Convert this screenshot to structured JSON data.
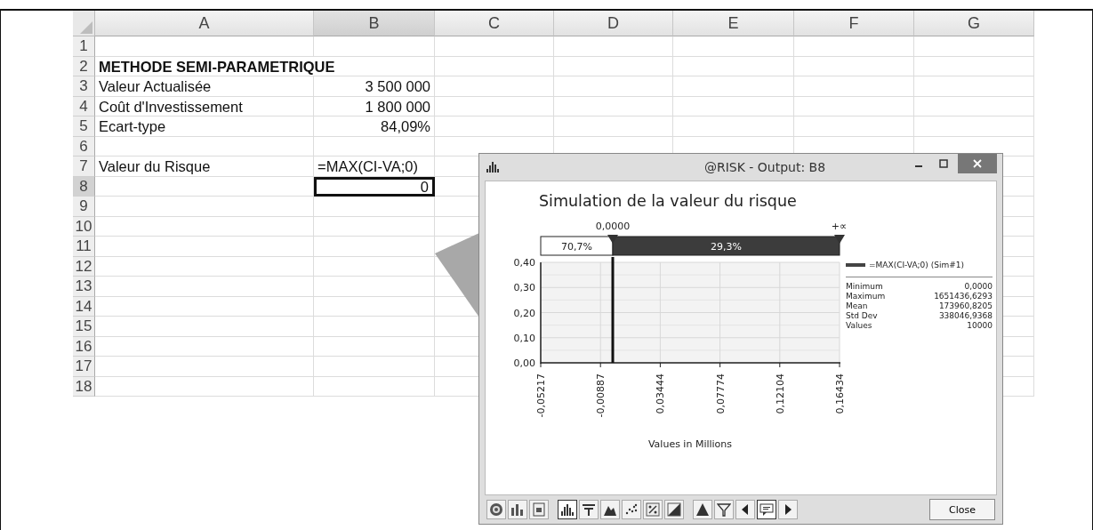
{
  "sheet": {
    "columns": [
      {
        "label": "A",
        "selected": false
      },
      {
        "label": "B",
        "selected": true
      },
      {
        "label": "C",
        "selected": false
      },
      {
        "label": "D",
        "selected": false
      },
      {
        "label": "E",
        "selected": false
      },
      {
        "label": "F",
        "selected": false
      },
      {
        "label": "G",
        "selected": false
      }
    ],
    "rows": [
      {
        "header": "1",
        "selected": false
      },
      {
        "header": "2",
        "selected": false,
        "a": {
          "text": "METHODE SEMI-PARAMETRIQUE",
          "bold": true
        }
      },
      {
        "header": "3",
        "selected": false,
        "a": {
          "text": "Valeur Actualisée",
          "bold": false
        },
        "b": {
          "text": "3 500 000",
          "kind": "number"
        }
      },
      {
        "header": "4",
        "selected": false,
        "a": {
          "text": "Coût d'Investissement",
          "bold": false
        },
        "b": {
          "text": "1 800 000",
          "kind": "number"
        }
      },
      {
        "header": "5",
        "selected": false,
        "a": {
          "text": "Ecart-type",
          "bold": false
        },
        "b": {
          "text": "84,09%",
          "kind": "number"
        }
      },
      {
        "header": "6",
        "selected": false
      },
      {
        "header": "7",
        "selected": false,
        "a": {
          "text": "Valeur du Risque",
          "bold": false
        },
        "b": {
          "text": "=MAX(CI-VA;0)",
          "kind": "text"
        }
      },
      {
        "header": "8",
        "selected": true,
        "b": {
          "text": "0",
          "kind": "number"
        }
      },
      {
        "header": "9",
        "selected": false
      },
      {
        "header": "10",
        "selected": false
      },
      {
        "header": "11",
        "selected": false
      },
      {
        "header": "12",
        "selected": false
      },
      {
        "header": "13",
        "selected": false
      },
      {
        "header": "14",
        "selected": false
      },
      {
        "header": "15",
        "selected": false
      },
      {
        "header": "16",
        "selected": false
      },
      {
        "header": "17",
        "selected": false
      },
      {
        "header": "18",
        "selected": false
      }
    ]
  },
  "window": {
    "title": "@RISK - Output: B8",
    "chart": {
      "title": "Simulation de la valeur du risque",
      "left_marker": "0,0000",
      "right_marker": "+∞",
      "left_share": "70,7%",
      "right_share": "29,3%",
      "yticks": [
        "0,40",
        "0,30",
        "0,20",
        "0,10",
        "0,00"
      ],
      "xticks": [
        "-0,05217",
        "-0,00887",
        "0,03444",
        "0,07774",
        "0,12104",
        "0,16434"
      ],
      "xlabel": "Values in Millions"
    },
    "legend": {
      "series": "=MAX(CI-VA;0) (Sim#1)",
      "stats": [
        {
          "name": "Minimum",
          "value": "0,0000"
        },
        {
          "name": "Maximum",
          "value": "1651436,6293"
        },
        {
          "name": "Mean",
          "value": "173960,8205"
        },
        {
          "name": "Std Dev",
          "value": "338046,9368"
        },
        {
          "name": "Values",
          "value": "10000"
        }
      ]
    },
    "close_button": "Close"
  }
}
